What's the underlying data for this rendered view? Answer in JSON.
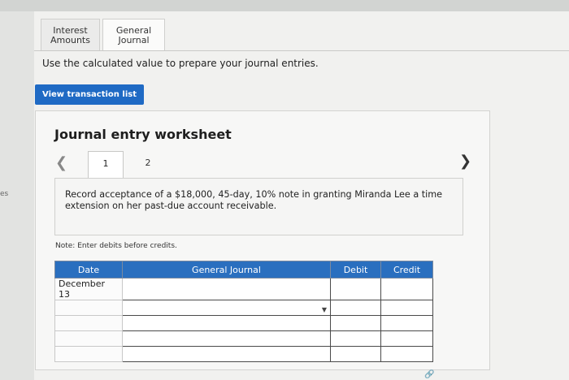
{
  "gutter_fragment": "es",
  "tabs": [
    {
      "label_line1": "Interest",
      "label_line2": "Amounts"
    },
    {
      "label_line1": "General",
      "label_line2": "Journal"
    }
  ],
  "instruction": "Use the calculated value to prepare your journal entries.",
  "view_button": "View transaction list",
  "worksheet": {
    "title": "Journal entry worksheet",
    "pages": [
      "1",
      "2"
    ],
    "description": "Record acceptance of a $18,000, 45-day, 10% note in granting Miranda Lee a time extension on her past-due account receivable.",
    "note": "Note: Enter debits before credits."
  },
  "table": {
    "headers": [
      "Date",
      "General Journal",
      "Debit",
      "Credit"
    ],
    "date_value": "December 13"
  },
  "colors": {
    "accent": "#1f6ac4",
    "header": "#2a6fbf"
  },
  "icons": {
    "prev": "chevron-left-icon",
    "next": "chevron-right-icon",
    "dropdown": "caret-down-icon",
    "link": "link-icon"
  }
}
